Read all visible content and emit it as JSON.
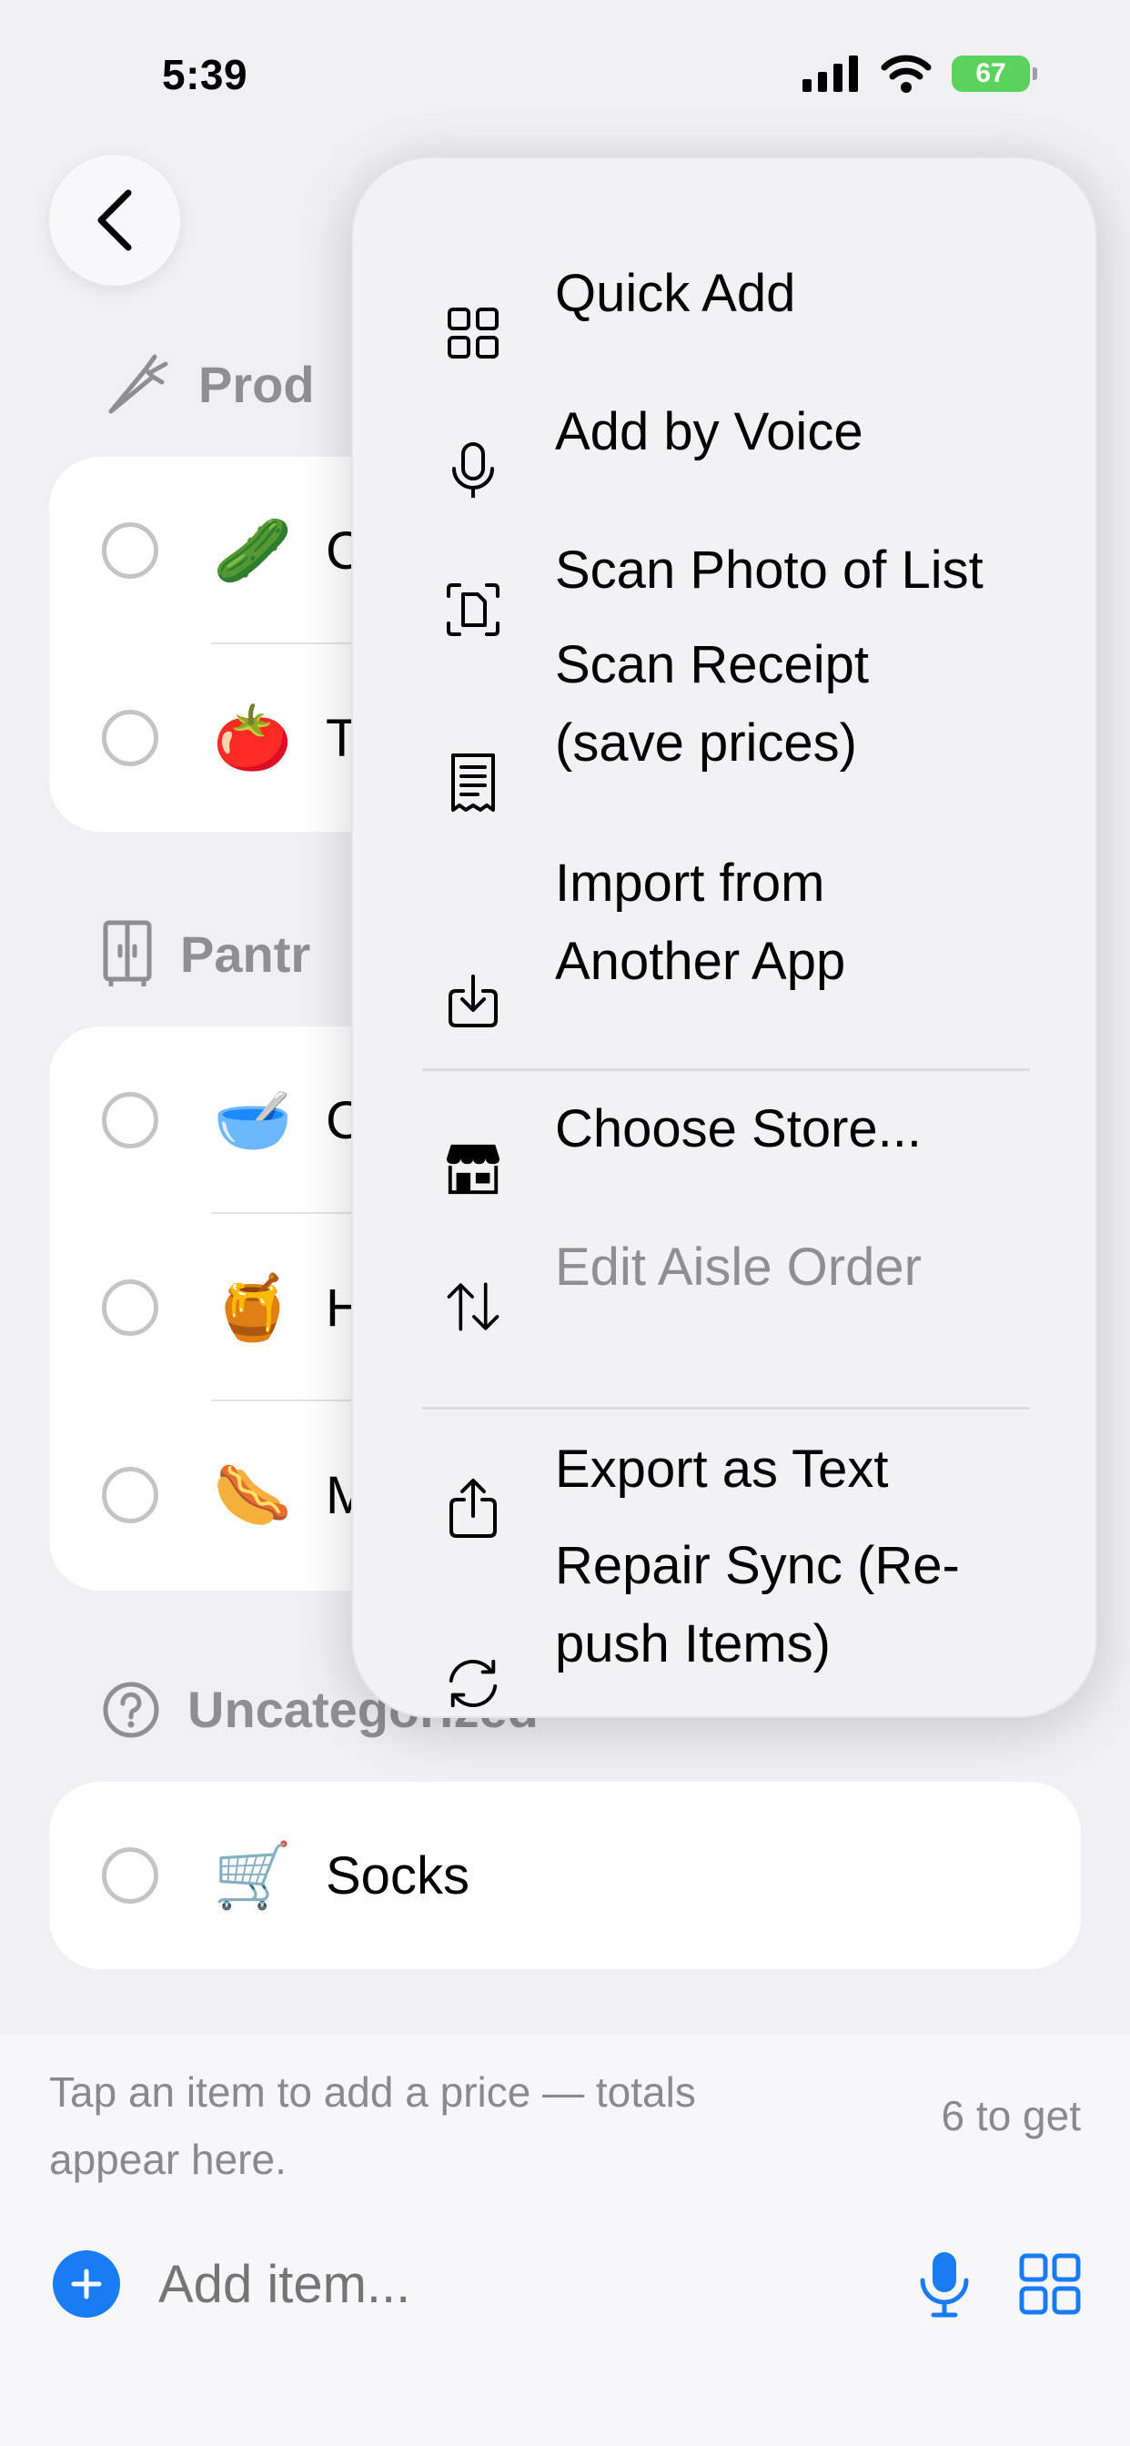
{
  "status_bar": {
    "time": "5:39",
    "battery": "67"
  },
  "sections": [
    {
      "title": "Prod",
      "icon": "carrot-icon",
      "items": [
        {
          "emoji": "🥒",
          "name": "C"
        },
        {
          "emoji": "🍅",
          "name": "T"
        }
      ]
    },
    {
      "title": "Pantr",
      "icon": "cabinet-icon",
      "items": [
        {
          "emoji": "🥣",
          "name": "C"
        },
        {
          "emoji": "🍯",
          "name": "H"
        },
        {
          "emoji": "🌭",
          "name": "M"
        }
      ]
    },
    {
      "title": "Uncategorized",
      "icon": "question-circle-icon",
      "items": [
        {
          "emoji": "🛒",
          "name": "Socks"
        }
      ]
    }
  ],
  "menu": {
    "items": [
      {
        "label": "Quick Add",
        "icon": "grid-icon"
      },
      {
        "label": "Add by Voice",
        "icon": "microphone-icon"
      },
      {
        "label": "Scan Photo of List",
        "icon": "scan-document-icon"
      },
      {
        "label": "Scan Receipt\n(save prices)",
        "icon": "receipt-icon"
      },
      {
        "label": "Import from\nAnother App",
        "icon": "import-icon"
      },
      {
        "label": "Choose Store...",
        "icon": "store-icon"
      },
      {
        "label": "Edit Aisle Order",
        "icon": "arrows-up-down-icon",
        "disabled": true
      },
      {
        "label": "Export as Text",
        "icon": "share-icon"
      },
      {
        "label": "Repair Sync (Re-push Items)",
        "icon": "sync-icon"
      }
    ]
  },
  "footer": {
    "hint": "Tap an item to add a price — totals appear here.",
    "count": "6 to get",
    "add_placeholder": "Add item..."
  },
  "colors": {
    "accent": "#1A7CF5",
    "background": "#EFEFF4",
    "battery": "#5BD25B"
  }
}
